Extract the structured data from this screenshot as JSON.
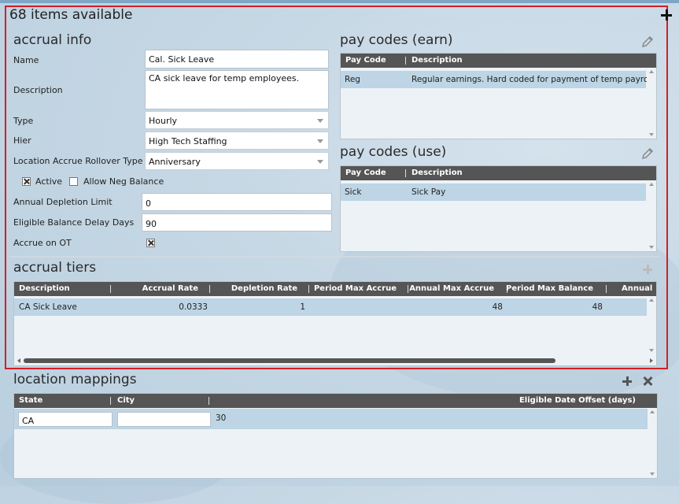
{
  "header": {
    "items_available": "68 items available"
  },
  "accrual_info": {
    "title": "accrual info",
    "name_label": "Name",
    "name_value": "Cal. Sick Leave",
    "description_label": "Description",
    "description_value": "CA sick leave for temp employees.",
    "type_label": "Type",
    "type_value": "Hourly",
    "hier_label": "Hier",
    "hier_value": "High Tech Staffing",
    "rollover_label": "Location Accrue Rollover Type",
    "rollover_value": "Anniversary",
    "active_label": "Active",
    "allow_neg_label": "Allow Neg Balance",
    "depletion_label": "Annual Depletion Limit",
    "depletion_value": "0",
    "delay_label": "Eligible Balance Delay Days",
    "delay_value": "90",
    "accrue_ot_label": "Accrue on OT"
  },
  "pay_codes_earn": {
    "title": "pay codes (earn)",
    "columns": [
      "Pay Code",
      "Description"
    ],
    "rows": [
      [
        "Reg",
        "Regular earnings.  Hard coded for payment of temp payroll"
      ]
    ]
  },
  "pay_codes_use": {
    "title": "pay codes (use)",
    "columns": [
      "Pay Code",
      "Description"
    ],
    "rows": [
      [
        "Sick",
        "Sick Pay"
      ]
    ]
  },
  "accrual_tiers": {
    "title": "accrual tiers",
    "columns": [
      "Description",
      "Accrual Rate",
      "Depletion Rate",
      "Period Max Accrue",
      "Annual Max Accrue",
      "Period Max Balance",
      "Annual"
    ],
    "rows": [
      [
        "CA Sick Leave",
        "0.0333",
        "1",
        "",
        "48",
        "48",
        ""
      ]
    ]
  },
  "location_mappings": {
    "title": "location mappings",
    "columns": [
      "State",
      "City",
      "Eligible Date Offset (days)"
    ],
    "rows": [
      [
        "CA",
        "",
        "30"
      ]
    ]
  },
  "icons": {
    "edit": "pencil-icon",
    "add": "plus-icon",
    "delete": "close-icon"
  }
}
